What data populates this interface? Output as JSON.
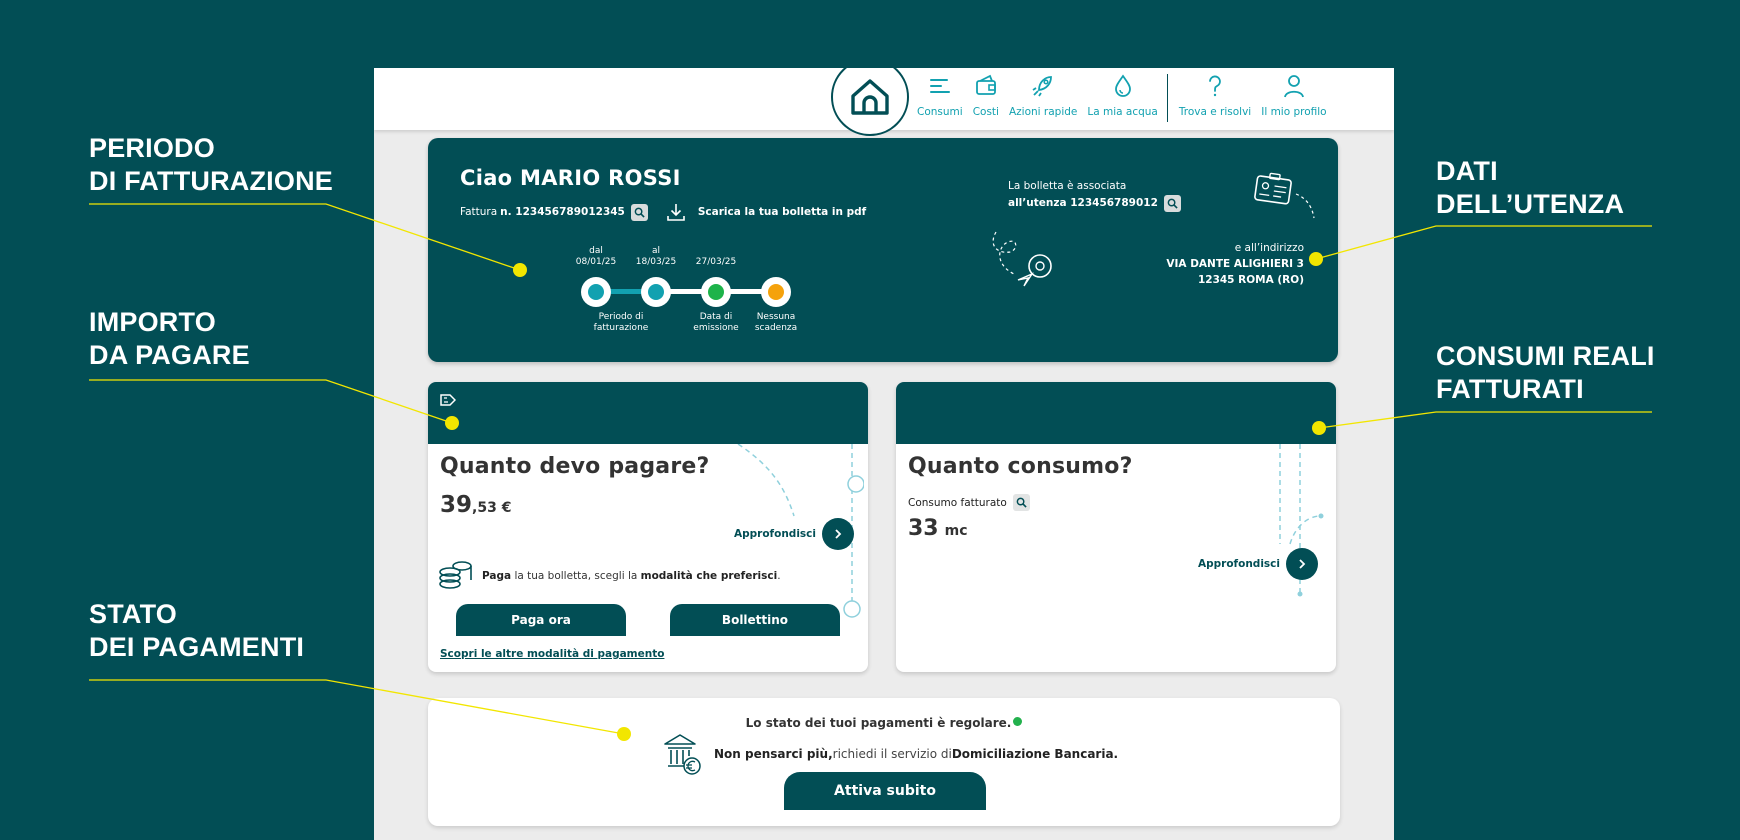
{
  "annotations": {
    "periodo": [
      "PERIODO",
      "DI FATTURAZIONE"
    ],
    "importo": [
      "IMPORTO",
      "DA PAGARE"
    ],
    "stato": [
      "STATO",
      "DEI PAGAMENTI"
    ],
    "dati": [
      "DATI",
      "DELL’UTENZA"
    ],
    "consumi": [
      "CONSUMI REALI",
      "FATTURATI"
    ],
    "line_color": "#f2e600"
  },
  "nav": {
    "items": [
      "Consumi",
      "Costi",
      "Azioni rapide",
      "La mia acqua"
    ],
    "secondary": [
      "Trova e risolvi",
      "Il mio profilo"
    ]
  },
  "hero": {
    "greeting": "Ciao MARIO ROSSI",
    "invoice_prefix": "Fattura",
    "invoice_number": "n. 123456789012345",
    "download": "Scarica la tua bolletta in pdf",
    "timeline": {
      "from_label": "dal",
      "from_date": "08/01/25",
      "to_label": "al",
      "to_date": "18/03/25",
      "issue_date": "27/03/25",
      "period_label": "Periodo di fatturazione",
      "issue_label_1": "Data di",
      "issue_label_2": "emissione",
      "due_label_1": "Nessuna",
      "due_label_2": "scadenza"
    },
    "assoc_line1": "La bolletta è associata",
    "assoc_line2": "all’utenza 123456789012",
    "address_intro": "e all’indirizzo",
    "address_line1": "VIA DANTE ALIGHIERI 3",
    "address_line2": "12345 ROMA (RO)"
  },
  "pay": {
    "title": "Quanto devo pagare?",
    "amount_int": "39",
    "amount_dec": ",53 €",
    "more": "Approfondisci",
    "text_b1": "Paga",
    "text_1": " la tua bolletta, scegli la ",
    "text_b2": "modalità che preferisci",
    "text_2": ".",
    "btn_pay": "Paga ora",
    "btn_slip": "Bollettino",
    "link": "Scopri le altre modalità di pagamento"
  },
  "consumption": {
    "title": "Quanto consumo?",
    "label": "Consumo fatturato",
    "value": "33",
    "unit": "mc",
    "more": "Approfondisci"
  },
  "status": {
    "line": "Lo stato dei tuoi pagamenti è regolare.",
    "promo_b": "Non pensarci più,",
    "promo_text": " richiedi il servizio di ",
    "promo_b2": "Domiciliazione Bancaria.",
    "button": "Attiva subito"
  },
  "colors": {
    "primary": "#024e55",
    "accent": "#12a1b0",
    "teal_dot": "#12a1b0",
    "green_dot": "#1db34a",
    "orange_dot": "#f5a20c"
  }
}
